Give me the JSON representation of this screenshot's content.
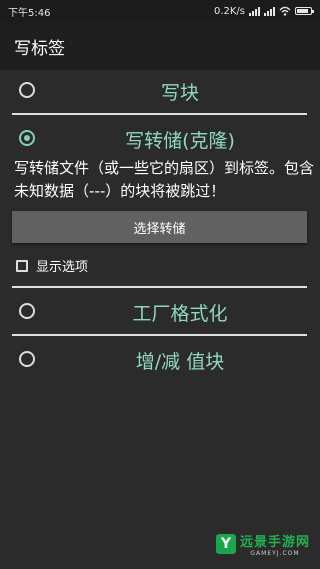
{
  "status_bar": {
    "time": "下午5:46",
    "net_speed": "0.2K/s"
  },
  "app_bar": {
    "title": "写标签"
  },
  "options": {
    "write_block": {
      "label": "写块",
      "selected": false
    },
    "write_dump": {
      "label": "写转储(克隆)",
      "selected": true
    },
    "factory_format": {
      "label": "工厂格式化",
      "selected": false
    },
    "inc_dec_value_block": {
      "label": "增/减 值块",
      "selected": false
    }
  },
  "write_dump_panel": {
    "description": "写转储文件（或一些它的扇区）到标签。包含未知数据（---）的块将被跳过！",
    "select_dump_button": "选择转储",
    "show_options_label": "显示选项",
    "show_options_checked": false
  },
  "watermark": {
    "title": "远景手游网",
    "subtitle": "GAMEYJ.COM"
  },
  "colors": {
    "accent": "#8fd9c3",
    "background": "#2b2b2b",
    "app_bar": "#1f1f1f",
    "button": "#616161"
  }
}
